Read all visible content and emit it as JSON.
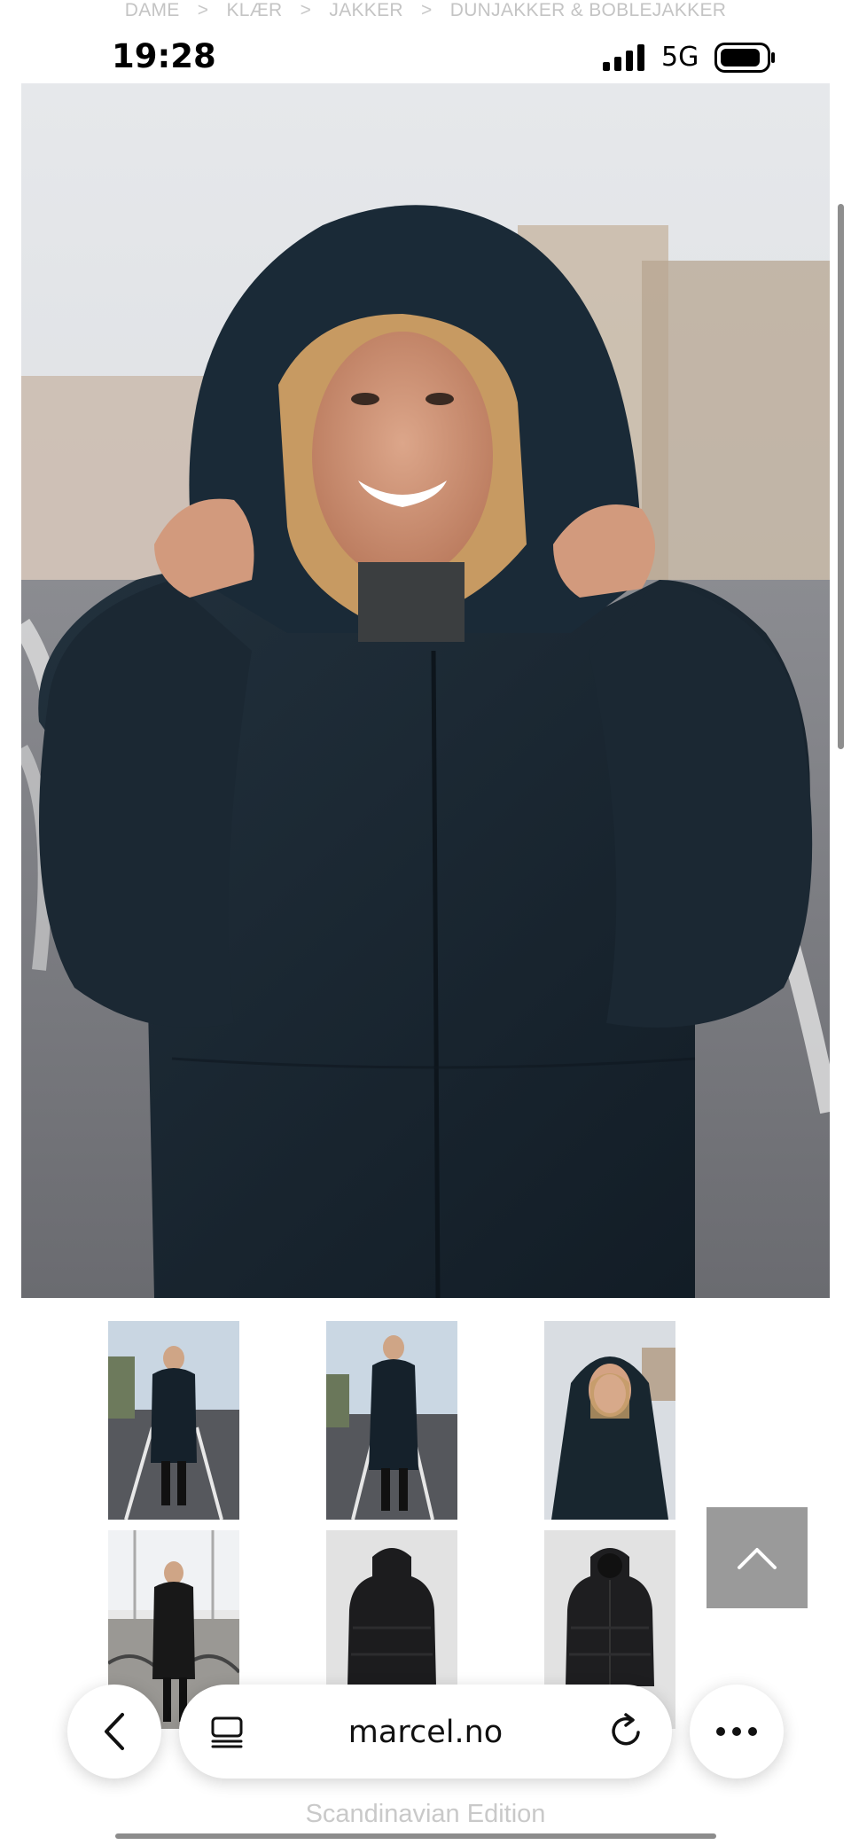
{
  "breadcrumb": {
    "items": [
      "DAME",
      "KLÆR",
      "JAKKER",
      "DUNJAKKER & BOBLEJAKKER"
    ],
    "separator": ">"
  },
  "status_bar": {
    "time": "19:28",
    "network": "5G",
    "signal_icon": "signal-bars-icon",
    "battery_icon": "battery-icon"
  },
  "product_gallery": {
    "main_image": "woman in dark navy hooded puffer coat",
    "thumbnails": [
      {
        "kind": "model-full-front"
      },
      {
        "kind": "model-full-walking"
      },
      {
        "kind": "model-hood-closeup"
      },
      {
        "kind": "model-indoor-graffiti"
      },
      {
        "kind": "product-back"
      },
      {
        "kind": "product-front"
      }
    ]
  },
  "back_to_top": {
    "icon": "chevron-up-icon"
  },
  "browser": {
    "url": "marcel.no",
    "back_icon": "chevron-left-icon",
    "tabs_icon": "tabs-icon",
    "reload_icon": "reload-icon",
    "more_icon": "more-dots-icon"
  },
  "footer": {
    "tagline": "Scandinavian Edition"
  },
  "colors": {
    "coat": "#18242e",
    "background": "#ffffff",
    "muted_text": "#c4c4c4",
    "back_to_top_bg": "#9a9a9a"
  }
}
